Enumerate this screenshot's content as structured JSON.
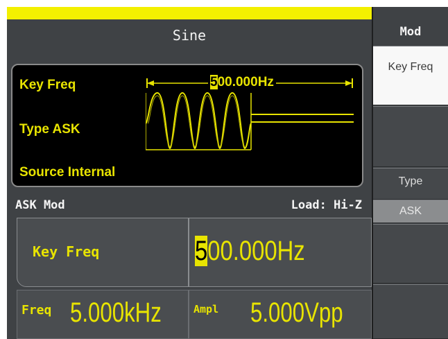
{
  "title": "Sine",
  "waveform_panel": {
    "key_freq_label": "Key Freq",
    "freq_display": "500.000Hz",
    "freq_cursor_digit": "5",
    "freq_rest": "00.000Hz",
    "type_label": "Type ASK",
    "source_label": "Source Internal"
  },
  "status": {
    "mode": "ASK Mod",
    "load": "Load: Hi-Z"
  },
  "params": {
    "key_freq_label": "Key Freq",
    "key_freq_cursor_digit": "5",
    "key_freq_rest": "00.000Hz",
    "freq_label": "Freq",
    "freq_value": "5.000kHz",
    "ampl_label": "Ampl",
    "ampl_value": "5.000Vpp"
  },
  "sidebar": {
    "header": "Mod",
    "key_freq_button": "Key Freq",
    "type_label": "Type",
    "type_value": "ASK"
  },
  "colors": {
    "accent_yellow": "#e8e400",
    "screen_bg": "#3f4245",
    "panel_bg": "#000000"
  }
}
